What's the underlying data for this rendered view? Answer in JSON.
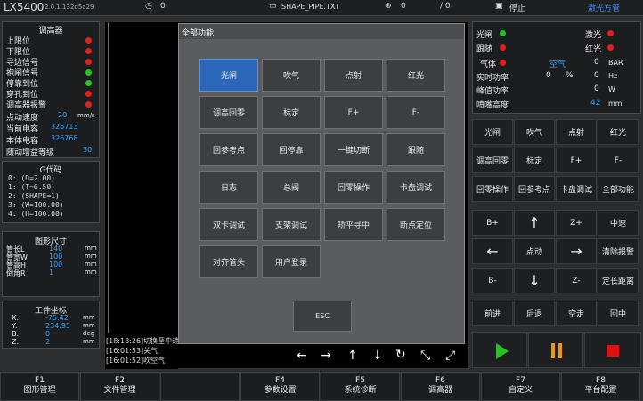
{
  "topbar": {
    "app": "LX5400",
    "version": "2.0.1.132d5a29",
    "timer_value": "0",
    "file_name": "SHAPE_PIPE.TXT",
    "counter_value": "0",
    "progress": "/ 0",
    "status": "停止",
    "laser_brand": "激光方管"
  },
  "limits": {
    "title": "调高器",
    "rows": [
      {
        "label": "上限位",
        "state": "red"
      },
      {
        "label": "下限位",
        "state": "red"
      },
      {
        "label": "寻边信号",
        "state": "red"
      },
      {
        "label": "抱闸信号",
        "state": "green"
      },
      {
        "label": "停靠到位",
        "state": "green"
      },
      {
        "label": "穿孔到位",
        "state": "red"
      },
      {
        "label": "调高器报警",
        "state": "red"
      }
    ],
    "values": [
      {
        "label": "点动速度",
        "value": "20",
        "unit": "mm/s"
      },
      {
        "label": "当前电容",
        "value": "326713",
        "unit": ""
      },
      {
        "label": "本体电容",
        "value": "326768",
        "unit": ""
      },
      {
        "label": "随动增益等级",
        "value": "30",
        "unit": ""
      }
    ]
  },
  "gcode": {
    "title": "G代码",
    "lines": [
      "0: (D=2.00)",
      "1: (T=0.50)",
      "2: (SHAPE=1)",
      "3: (W=100.00)",
      "4: (H=100.00)"
    ]
  },
  "shape": {
    "title": "图形尺寸",
    "rows": [
      {
        "label": "管长L",
        "value": "140",
        "unit": "mm"
      },
      {
        "label": "管宽W",
        "value": "100",
        "unit": "mm"
      },
      {
        "label": "管高H",
        "value": "100",
        "unit": "mm"
      },
      {
        "label": "倒角R",
        "value": "1",
        "unit": "mm"
      }
    ]
  },
  "coords": {
    "title": "工件坐标",
    "rows": [
      {
        "label": "X:",
        "value": "-75.42",
        "unit": "mm"
      },
      {
        "label": "Y:",
        "value": "234.95",
        "unit": "mm"
      },
      {
        "label": "B:",
        "value": "0",
        "unit": "deg"
      },
      {
        "label": "Z:",
        "value": "2",
        "unit": "mm"
      }
    ]
  },
  "log": {
    "lines": [
      "[18:18:26]切换至中速",
      "[16:01:53]关气",
      "[16:01:52]吹空气"
    ]
  },
  "status_panel": {
    "shutter": "光闸",
    "laser": "激光",
    "follow": "跟随",
    "red_light": "红光",
    "gas_label": "气体",
    "gas_type": "空气",
    "gas_value": "0",
    "gas_unit": "BAR",
    "power_label": "实时功率",
    "power_value": "0",
    "power_pct": "%",
    "power_hz": "0",
    "power_hz_unit": "Hz",
    "peak_label": "峰值功率",
    "peak_value": "0",
    "peak_unit": "W",
    "nozzle_label": "喷嘴高度",
    "nozzle_value": "42",
    "nozzle_unit": "mm"
  },
  "right_buttons": [
    [
      "光闸",
      "吹气",
      "点射",
      "红光"
    ],
    [
      "调高回零",
      "标定",
      "F+",
      "F-"
    ],
    [
      "回零操作",
      "回参考点",
      "卡盘调试",
      "全部功能"
    ]
  ],
  "jog": {
    "b_plus": "B+",
    "z_plus": "Z+",
    "mid_speed": "中速",
    "jog_mode": "点动",
    "clear_alarm": "清除报警",
    "b_minus": "B-",
    "z_minus": "Z-",
    "fixed_len": "定长距离",
    "forward": "前进",
    "backward": "后退",
    "idle_move": "空走",
    "return_mid": "回中"
  },
  "dialog": {
    "title": "全部功能",
    "buttons": [
      [
        "光闸",
        "吹气",
        "点射",
        "红光"
      ],
      [
        "调高回零",
        "标定",
        "F+",
        "F-"
      ],
      [
        "回参考点",
        "回停靠",
        "一键切断",
        "跟随"
      ],
      [
        "日志",
        "总阀",
        "回零操作",
        "卡盘调试"
      ],
      [
        "双卡调试",
        "支架调试",
        "矫平寻中",
        "断点定位"
      ],
      [
        "对齐管头",
        "用户登录",
        "",
        ""
      ]
    ],
    "esc": "ESC"
  },
  "fkeys": [
    {
      "key": "F1",
      "label": "图形管理"
    },
    {
      "key": "F2",
      "label": "文件管理"
    },
    {
      "key": "",
      "label": ""
    },
    {
      "key": "F4",
      "label": "参数设置"
    },
    {
      "key": "F5",
      "label": "系统诊断"
    },
    {
      "key": "F6",
      "label": "调高器"
    },
    {
      "key": "F7",
      "label": "自定义"
    },
    {
      "key": "F8",
      "label": "平台配置"
    }
  ],
  "colors": {
    "accent_blue": "#2c66b8",
    "value_blue": "#39a3ff",
    "red": "#e02020",
    "green": "#22c422",
    "play_green": "#22c422",
    "pause_orange": "#e89a10",
    "stop_red": "#e01010",
    "laser_brand": "#3d8bff"
  }
}
